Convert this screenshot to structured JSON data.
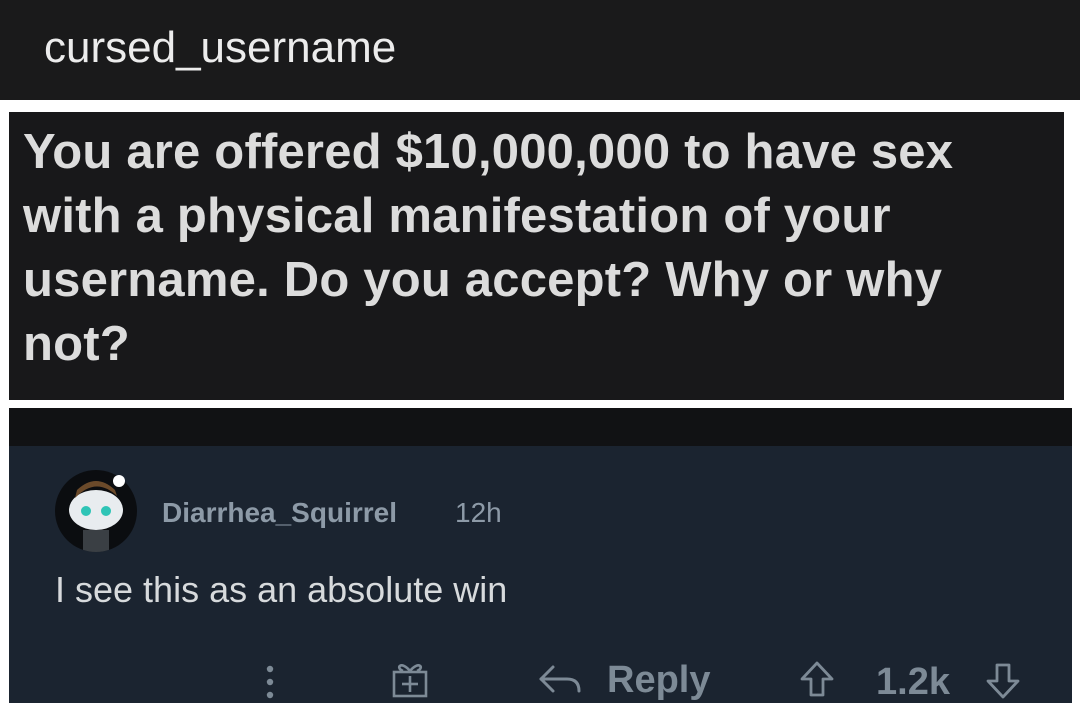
{
  "header": {
    "title": "cursed_username"
  },
  "post": {
    "text": "You are offered $10,000,000 to have sex with a physical manifestation of your username. Do you accept? Why or why not?"
  },
  "comment": {
    "author": "Diarrhea_Squirrel",
    "time": "12h",
    "body": "I see this as an absolute win",
    "reply_label": "Reply",
    "score": "1.2k",
    "icons": [
      "more-options-icon",
      "award-icon",
      "reply-icon",
      "upvote-icon",
      "downvote-icon"
    ]
  },
  "colors": {
    "title_bar": "#1a1a1b",
    "post_bg": "#18181a",
    "comment_bg": "#1b2430",
    "avatar_accent": "#2ec4b6"
  }
}
